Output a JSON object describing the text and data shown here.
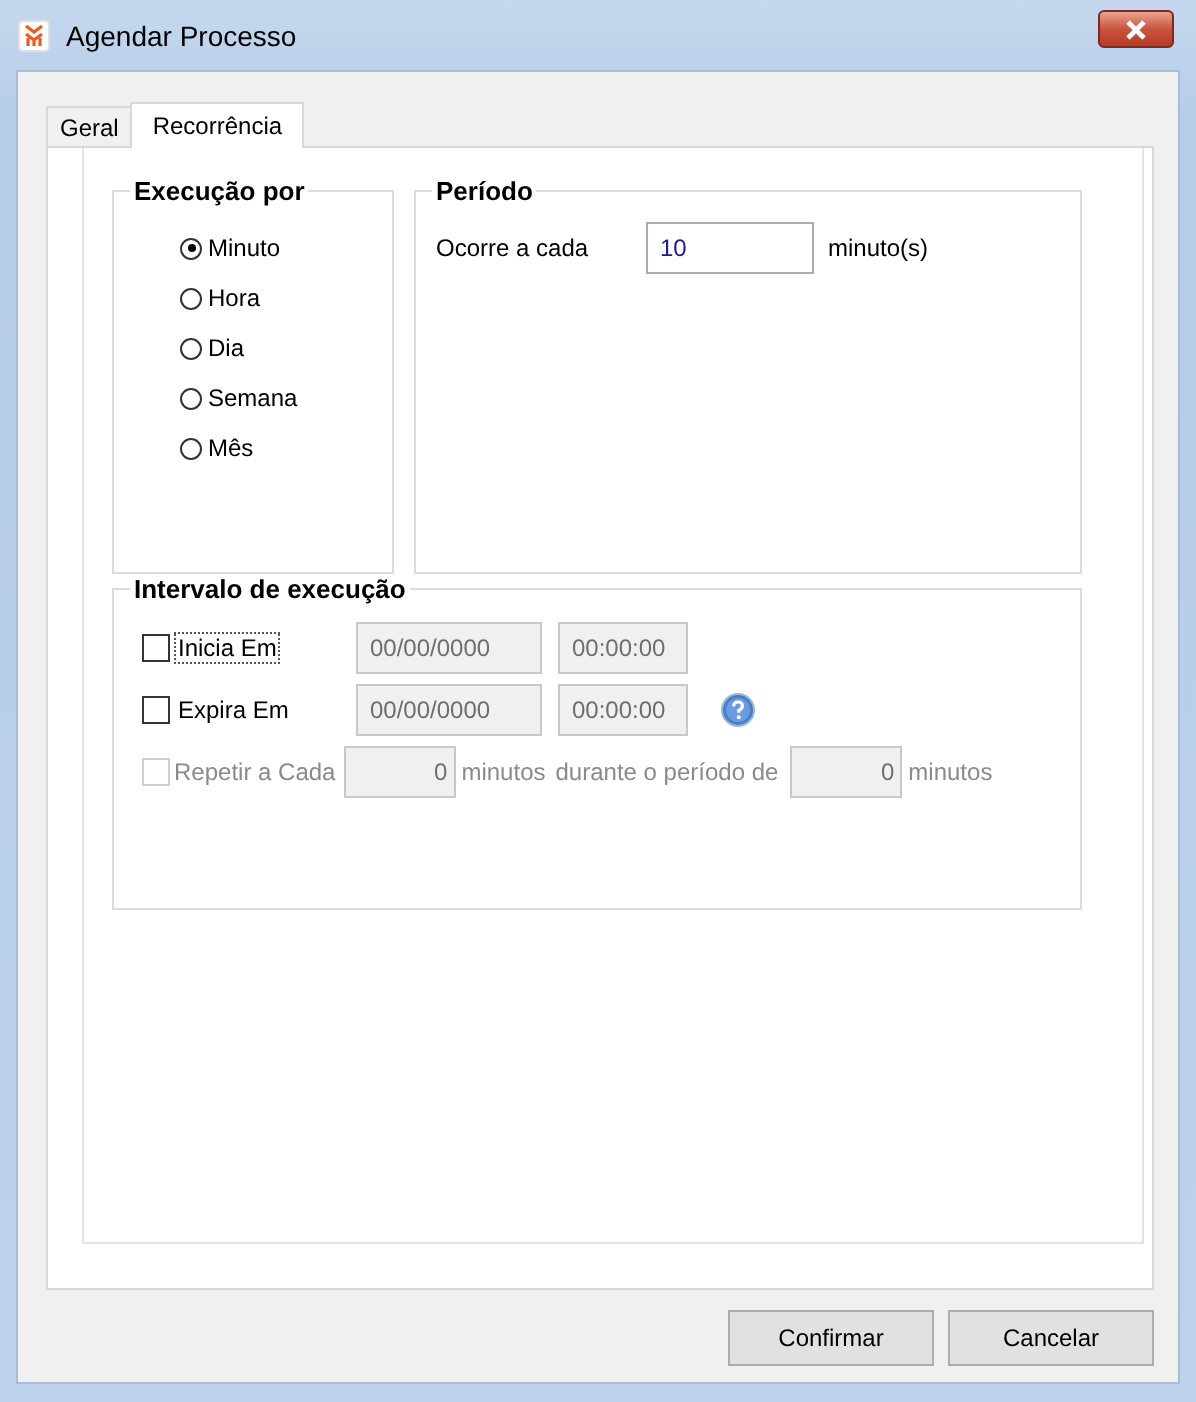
{
  "window": {
    "title": "Agendar Processo"
  },
  "tabs": [
    {
      "label": "Geral",
      "selected": false
    },
    {
      "label": "Recorrência",
      "selected": true
    }
  ],
  "execucao": {
    "title": "Execução por",
    "options": [
      {
        "label": "Minuto",
        "selected": true
      },
      {
        "label": "Hora",
        "selected": false
      },
      {
        "label": "Dia",
        "selected": false
      },
      {
        "label": "Semana",
        "selected": false
      },
      {
        "label": "Mês",
        "selected": false
      }
    ]
  },
  "periodo": {
    "title": "Período",
    "label": "Ocorre a cada",
    "value": "10",
    "unit": "minuto(s)"
  },
  "intervalo": {
    "title": "Intervalo de execução",
    "rows": [
      {
        "label": "Inicia Em",
        "checked": false,
        "focused": true,
        "date": "00/00/0000",
        "time": "00:00:00",
        "help": false
      },
      {
        "label": "Expira Em",
        "checked": false,
        "focused": false,
        "date": "00/00/0000",
        "time": "00:00:00",
        "help": true
      }
    ],
    "repeat": {
      "label": "Repetir a Cada",
      "checked": false,
      "disabled": true,
      "every": "0",
      "unit": "minutos",
      "during_label": "durante o período de",
      "duration": "0",
      "duration_unit": "minutos"
    }
  },
  "buttons": [
    {
      "label": "Confirmar"
    },
    {
      "label": "Cancelar"
    }
  ]
}
